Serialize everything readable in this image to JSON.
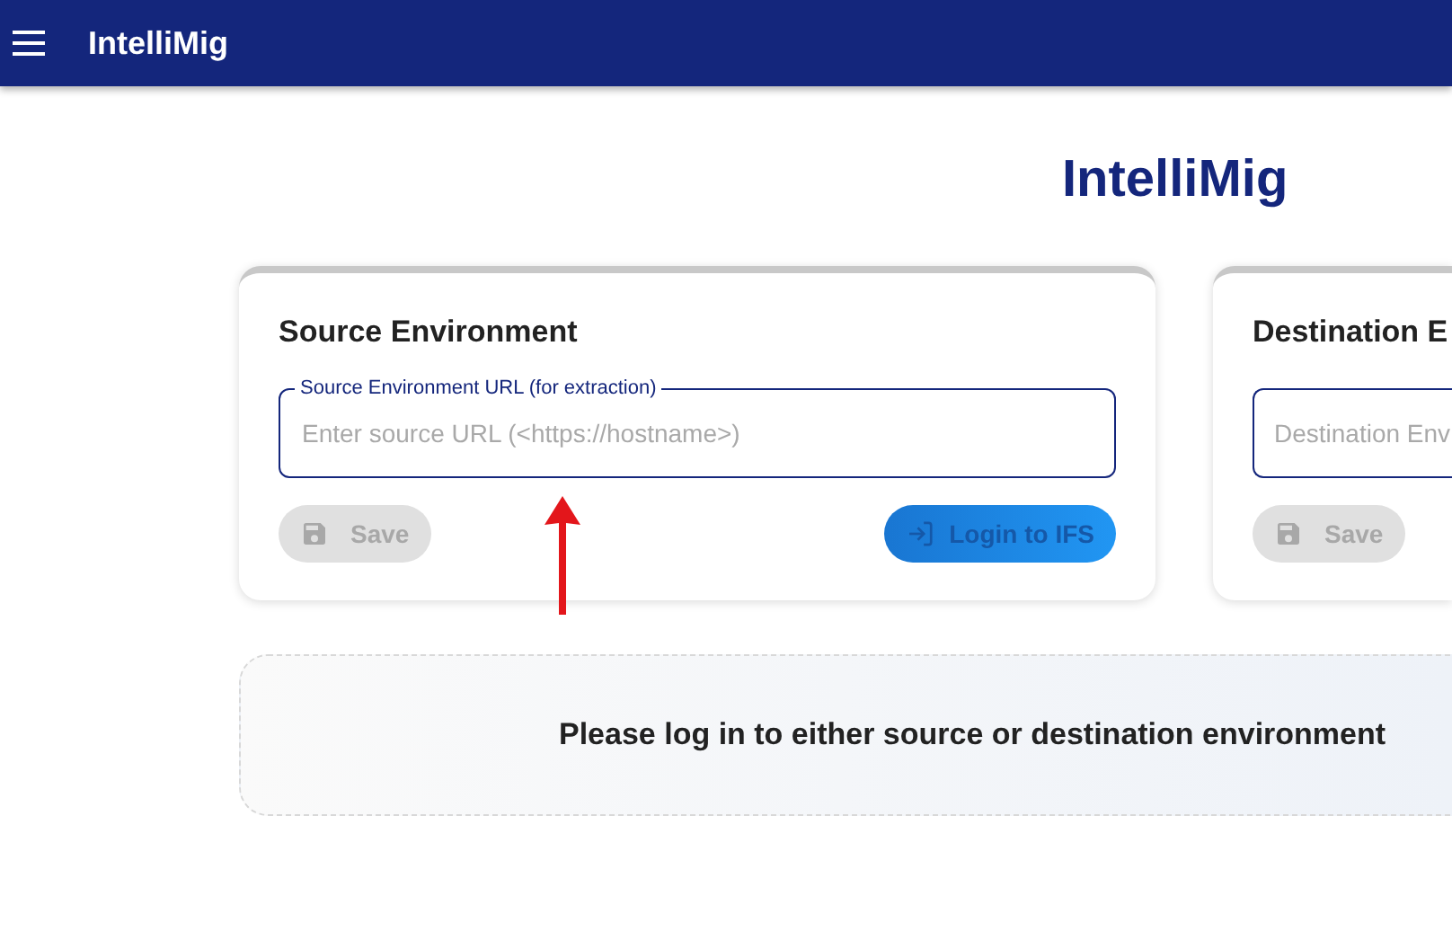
{
  "app_bar": {
    "title": "IntelliMig"
  },
  "page_title": "IntelliMig",
  "cards": [
    {
      "title": "Source Environment",
      "field": {
        "label": "Source Environment URL (for extraction)",
        "placeholder": "Enter source URL (<https://hostname>)"
      },
      "buttons": [
        {
          "kind": "save",
          "label": "Save",
          "disabled": true
        },
        {
          "kind": "login",
          "label": "Login to IFS",
          "disabled": true
        }
      ]
    },
    {
      "title": "Destination E",
      "field": {
        "placeholder": "Destination Env"
      },
      "buttons": [
        {
          "kind": "save",
          "label": "Save",
          "disabled": true
        }
      ]
    }
  ],
  "notice": "Please log in to either source or destination environment"
}
